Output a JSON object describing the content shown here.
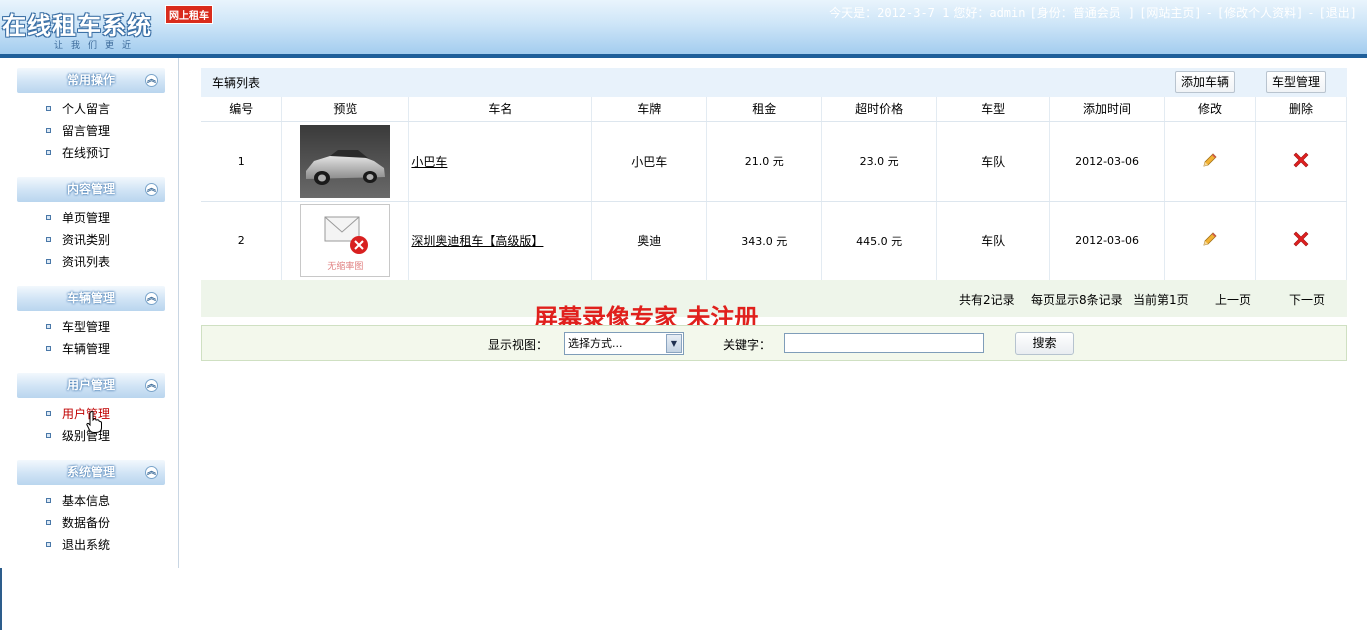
{
  "header": {
    "logo_title": "在线租车系统",
    "logo_badge": "网上租车",
    "logo_slogan": "让我们更近",
    "date_text": "今天是：2012-3-7 1",
    "greeting": "您好：admin",
    "role": "[身份：普通会员 ]",
    "link_home": "[网站主页]",
    "sep1": "-",
    "link_profile": "[修改个人资料]",
    "sep2": "-",
    "link_logout": "[退出]"
  },
  "sidebar": {
    "groups": [
      {
        "title": "常用操作",
        "items": [
          "个人留言",
          "留言管理",
          "在线预订"
        ]
      },
      {
        "title": "内容管理",
        "items": [
          "单页管理",
          "资讯类别",
          "资讯列表"
        ]
      },
      {
        "title": "车辆管理",
        "items": [
          "车型管理",
          "车辆管理"
        ]
      },
      {
        "title": "用户管理",
        "items": [
          "用户管理",
          "级别管理"
        ]
      },
      {
        "title": "系统管理",
        "items": [
          "基本信息",
          "数据备份",
          "退出系统"
        ]
      }
    ],
    "active_item": "用户管理",
    "collapse_icon": "chevron-up-icon"
  },
  "main": {
    "list_title": "车辆列表",
    "add_button": "添加车辆",
    "type_button": "车型管理",
    "columns": [
      "编号",
      "预览",
      "车名",
      "车牌",
      "租金",
      "超时价格",
      "车型",
      "添加时间",
      "修改",
      "删除"
    ],
    "rows": [
      {
        "id": "1",
        "preview": "car-photo",
        "name": "小巴车",
        "plate": "小巴车",
        "rent": "21.0 元",
        "overtime": "23.0 元",
        "type": "车队",
        "date": "2012-03-06"
      },
      {
        "id": "2",
        "preview": "no-image",
        "preview_caption": "无缩率图",
        "name": "深圳奥迪租车【高级版】",
        "plate": "奥迪",
        "rent": "343.0 元",
        "overtime": "445.0 元",
        "type": "车队",
        "date": "2012-03-06"
      }
    ],
    "edit_icon": "pencil-icon",
    "delete_icon": "red-x-icon"
  },
  "pager": {
    "total": "共有2记录",
    "per_page": "每页显示8条记录",
    "current": "当前第1页",
    "prev": "上一页",
    "next": "下一页"
  },
  "watermark": "屏幕录像专家  未注册",
  "search": {
    "view_label": "显示视图：",
    "view_selected": "选择方式...",
    "keyword_label": "关键字：",
    "keyword_value": "",
    "button": "搜索"
  },
  "colors": {
    "header_blue": "#9fcaee",
    "header_line": "#1f5f9a",
    "watermark_red": "#e0201c",
    "delete_red": "#e02020",
    "edit_orange": "#f0a020",
    "pager_bg": "#eef5ea"
  }
}
